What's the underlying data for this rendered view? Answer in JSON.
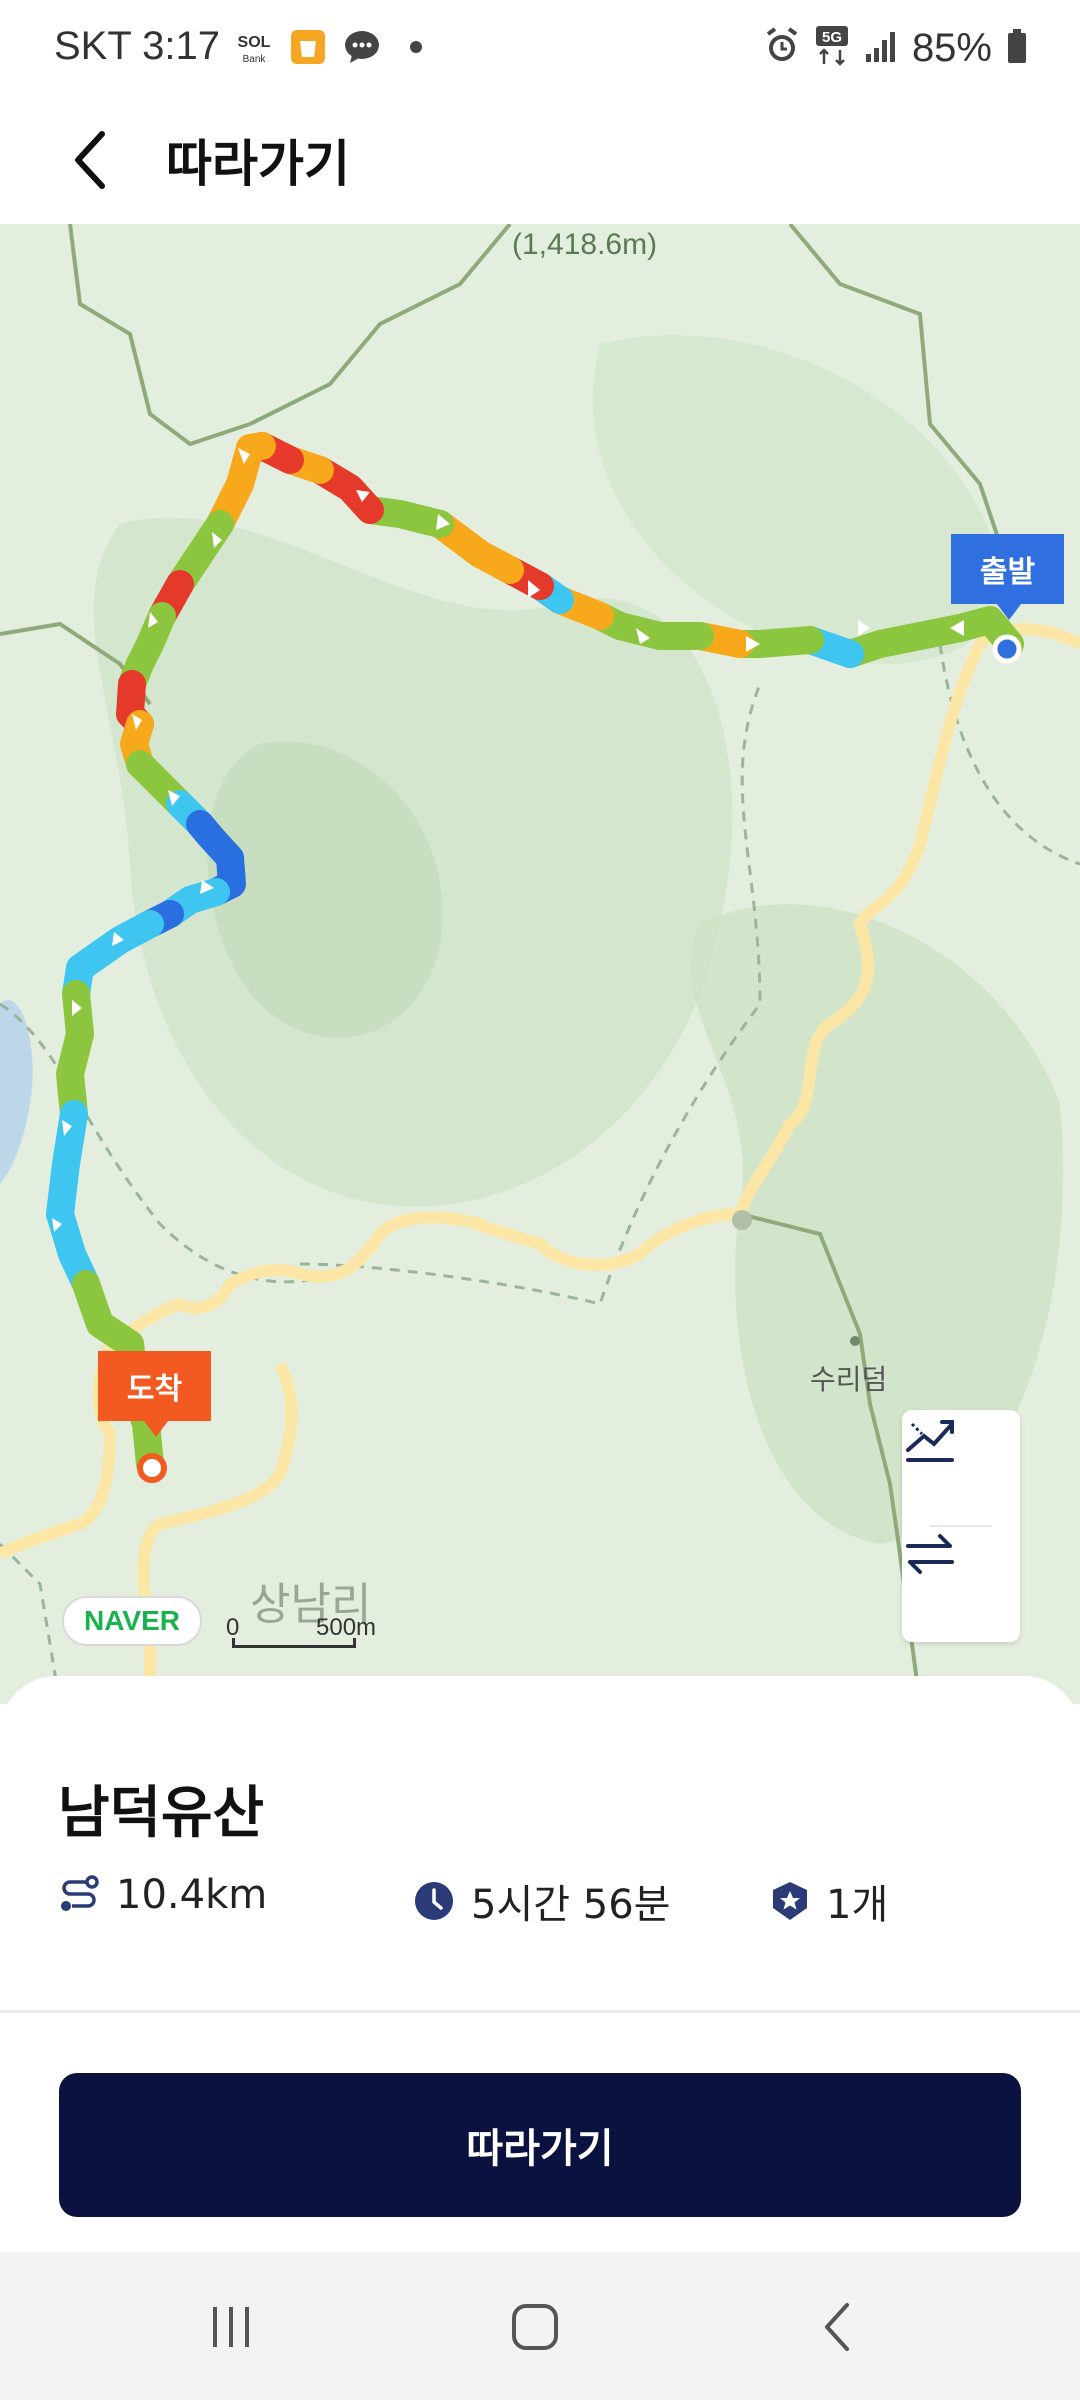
{
  "status_bar": {
    "carrier_time": "SKT 3:17",
    "notification_icons": [
      "sol-bank-icon",
      "shopping-bag-icon",
      "chat-bubble-icon",
      "dot-icon"
    ],
    "bank_text": "SOL",
    "bank_subtext": "Bank",
    "right_icons": [
      "alarm-icon",
      "5g-icon",
      "signal-icon"
    ],
    "network": "5G",
    "battery": "85%"
  },
  "header": {
    "title": "따라가기",
    "back_icon": "chevron-left-icon"
  },
  "map": {
    "peak_label": "(1,418.6m)",
    "start_label": "출발",
    "end_label": "도착",
    "place_label": "수리덤",
    "village_label": "상남리",
    "provider": "NAVER",
    "scale_zero": "0",
    "scale_distance": "500m",
    "controls": [
      "elevation-icon",
      "reverse-route-icon"
    ],
    "colors": {
      "route_red": "#e53a2b",
      "route_orange": "#f7a81b",
      "route_green": "#8cc63f",
      "route_lightblue": "#3ec5f0",
      "route_blue": "#2a6fe0",
      "start_marker": "#2f6fe0",
      "end_marker": "#f25a22"
    }
  },
  "course": {
    "name": "남덕유산",
    "distance": "10.4km",
    "duration": "5시간 56분",
    "badge_count": "1개",
    "icons": [
      "route-icon",
      "clock-icon",
      "badge-icon"
    ]
  },
  "follow_button": "따라가기",
  "nav_bar": [
    "recent-apps-icon",
    "home-icon",
    "back-icon"
  ]
}
